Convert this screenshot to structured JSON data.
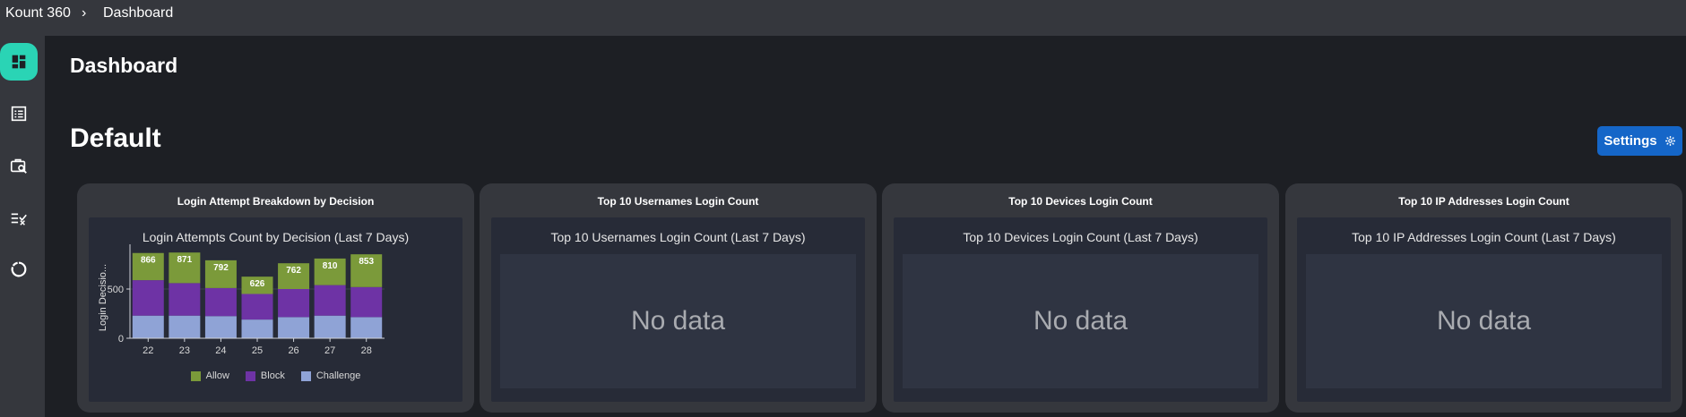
{
  "topbar": {
    "app_name": "Kount 360",
    "separator": "›",
    "page": "Dashboard"
  },
  "sidebar": {
    "items": [
      {
        "name": "dashboard-icon",
        "active": true
      },
      {
        "name": "list-icon",
        "active": false
      },
      {
        "name": "briefcase-search-icon",
        "active": false
      },
      {
        "name": "checklist-icon",
        "active": false
      },
      {
        "name": "donut-chart-icon",
        "active": false
      }
    ]
  },
  "main": {
    "title": "Dashboard",
    "section_title": "Default",
    "settings_label": "Settings",
    "settings_icon": "gear-icon"
  },
  "cards": [
    {
      "title": "Login Attempt Breakdown by Decision",
      "chart_title": "Login Attempts Count by Decision  (Last 7 Days)"
    },
    {
      "title": "Top 10 Usernames Login Count",
      "chart_title": "Top 10 Usernames Login Count (Last 7 Days)",
      "empty_text": "No data"
    },
    {
      "title": "Top 10 Devices Login Count",
      "chart_title": "Top 10 Devices Login Count (Last 7 Days)",
      "empty_text": "No data"
    },
    {
      "title": "Top 10 IP Addresses Login Count",
      "chart_title": "Top 10 IP Addresses Login Count (Last 7 Days)",
      "empty_text": "No data"
    }
  ],
  "colors": {
    "allow": "#7b9a3a",
    "block": "#6e33a5",
    "challenge": "#8fa3d6",
    "accent": "#2ad4b5",
    "settings": "#1566c8"
  },
  "chart_data": {
    "type": "bar",
    "stacked": true,
    "title": "Login Attempts Count by Decision  (Last 7 Days)",
    "xlabel": "",
    "ylabel": "Login Decisio...",
    "ylim": [
      0,
      900
    ],
    "yticks": [
      0,
      500
    ],
    "grid": true,
    "legend_position": "bottom",
    "categories": [
      "22",
      "23",
      "24",
      "25",
      "26",
      "27",
      "28"
    ],
    "totals": [
      866,
      871,
      792,
      626,
      762,
      810,
      853
    ],
    "series": [
      {
        "name": "Challenge",
        "values": [
          230,
          230,
          225,
          190,
          215,
          230,
          215
        ]
      },
      {
        "name": "Block",
        "values": [
          360,
          330,
          285,
          260,
          285,
          310,
          305
        ]
      },
      {
        "name": "Allow",
        "values": [
          276,
          311,
          282,
          176,
          262,
          270,
          333
        ]
      }
    ]
  }
}
